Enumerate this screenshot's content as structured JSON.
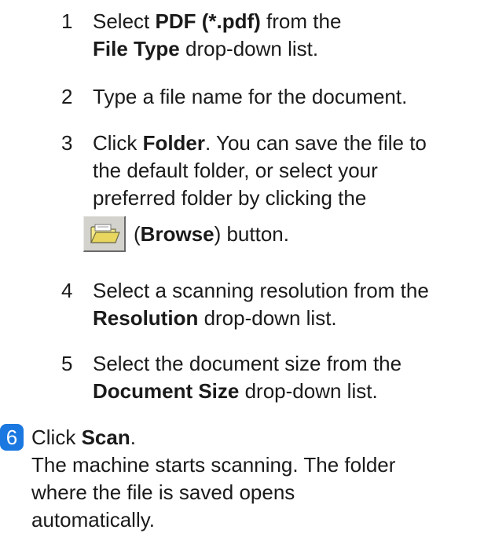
{
  "steps": [
    {
      "number": "1",
      "line1_prefix": "Select ",
      "line1_bold": "PDF (*.pdf)",
      "line1_suffix": " from the",
      "line2_bold": "File Type",
      "line2_suffix": " drop-down list."
    },
    {
      "number": "2",
      "line1": "Type a file name for the document."
    },
    {
      "number": "3",
      "line1_prefix": "Click ",
      "line1_bold": "Folder",
      "line1_suffix": ". You can save the file to",
      "line2": "the default folder, or select your",
      "line3": "preferred folder by clicking the",
      "browse_open": "(",
      "browse_bold": "Browse",
      "browse_suffix": ") button."
    },
    {
      "number": "4",
      "line1": "Select a scanning resolution from the",
      "line2_bold": "Resolution",
      "line2_suffix": " drop-down list."
    },
    {
      "number": "5",
      "line1": "Select the document size from the",
      "line2_bold": "Document Size",
      "line2_suffix": " drop-down list."
    }
  ],
  "step6": {
    "badge": "6",
    "line1_prefix": "Click ",
    "line1_bold": "Scan",
    "line1_suffix": ".",
    "line2": "The machine starts scanning. The folder",
    "line3": "where the file is saved opens",
    "line4": "automatically."
  },
  "colors": {
    "badge": "#1a78e0",
    "text": "#1a1a1a"
  },
  "icons": {
    "browse_button": "folder-icon"
  }
}
